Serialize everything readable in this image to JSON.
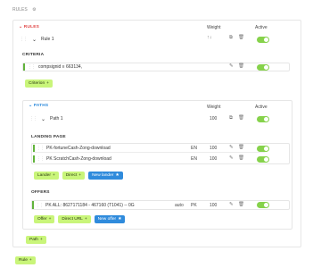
{
  "page": {
    "title": "RULES"
  },
  "rules_header": {
    "label": "RULES",
    "weight": "Weight",
    "active": "Active"
  },
  "rule": {
    "name": "Rule 1",
    "criteria_label": "CRITERIA",
    "criteria_item": "compsignid ≡ 663134,",
    "criterion_button": "Criterion",
    "paths_label": "PATHS",
    "paths_weight": "Weight",
    "paths_active": "Active",
    "path": {
      "name": "Path 1",
      "weight": "100",
      "landing_label": "LANDING PAGE",
      "landers": [
        {
          "name": "PK-fortuneCash-Zong-download",
          "lang": "EN",
          "weight": "100"
        },
        {
          "name": "PK ScratchCash-Zong-download",
          "lang": "EN",
          "weight": "100"
        }
      ],
      "lander_buttons": {
        "lander": "Lander",
        "direct": "Direct",
        "new_lander": "New lander"
      },
      "offers_label": "OFFERS",
      "offer": {
        "name": "PK ALL: 8627171184 - 467160 (T1041) -- 0G",
        "mode": "auto",
        "lang": "PK",
        "weight": "100"
      },
      "offer_buttons": {
        "offer": "Offer",
        "direct_url": "Direct URL",
        "new_offer": "New offer"
      }
    },
    "path_button": "Path"
  },
  "rule_button": "Rule",
  "colors": {
    "accent_green": "#86d24b",
    "button_green": "#c9f57a",
    "blue": "#2f8bdc",
    "red": "#e04545"
  }
}
